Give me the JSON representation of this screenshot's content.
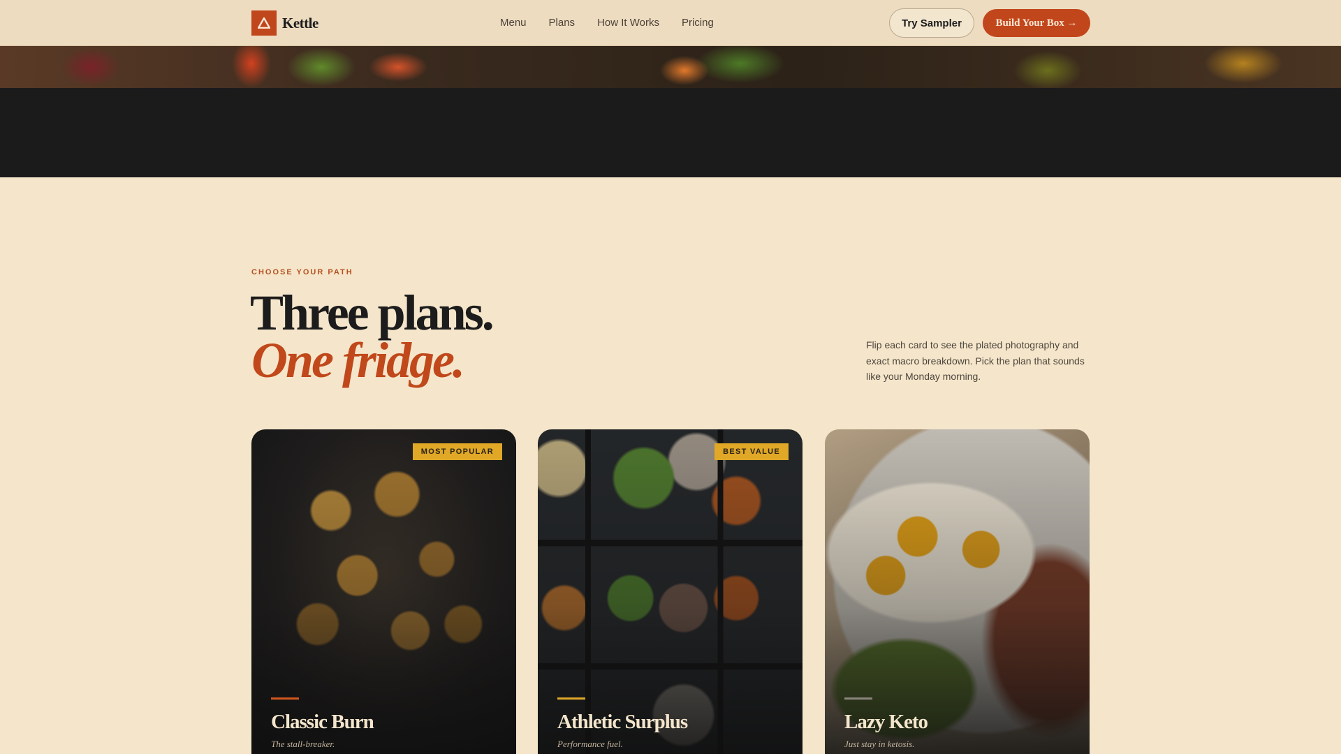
{
  "brand": {
    "name": "Kettle"
  },
  "nav": {
    "links": [
      "Menu",
      "Plans",
      "How It Works",
      "Pricing"
    ],
    "try_sampler": "Try Sampler",
    "build_box": "Build Your Box →"
  },
  "section": {
    "eyebrow": "CHOOSE YOUR PATH",
    "headline_line1": "Three plans.",
    "headline_line2": "One fridge.",
    "intro": "Flip each card to see the plated photography and exact macro breakdown. Pick the plan that sounds like your Monday morning."
  },
  "plans": [
    {
      "title": "Classic Burn",
      "subtitle": "The stall-breaker.",
      "badge": "MOST POPULAR",
      "image": "roasted-cauliflower-photo"
    },
    {
      "title": "Athletic Surplus",
      "subtitle": "Performance fuel.",
      "badge": "BEST VALUE",
      "image": "meal-prep-containers-photo"
    },
    {
      "title": "Lazy Keto",
      "subtitle": "Just stay in ketosis.",
      "badge": "",
      "image": "eggs-bacon-avocado-photo"
    }
  ],
  "colors": {
    "accent": "#c2461b",
    "badge": "#e0a826",
    "background": "#f5e6cb",
    "dark_band": "#1b1b1c"
  }
}
